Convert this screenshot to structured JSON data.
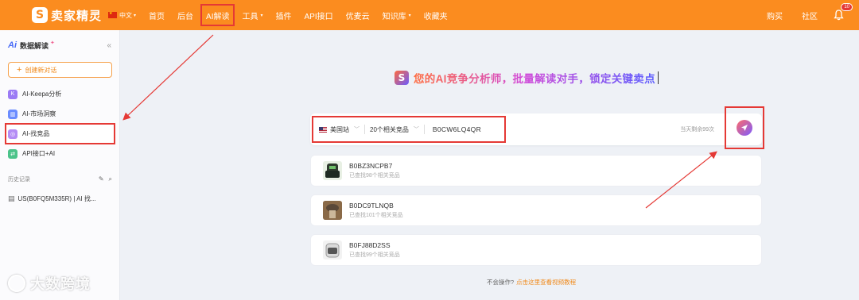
{
  "nav": {
    "logo_mark": "S",
    "brand": "卖家精灵",
    "lang": "中文",
    "items": [
      {
        "label": "首页",
        "caret": false
      },
      {
        "label": "后台",
        "caret": false
      },
      {
        "label": "AI解读",
        "caret": false
      },
      {
        "label": "工具",
        "caret": true
      },
      {
        "label": "插件",
        "caret": false
      },
      {
        "label": "API接口",
        "caret": false
      },
      {
        "label": "优麦云",
        "caret": false
      },
      {
        "label": "知识库",
        "caret": true
      },
      {
        "label": "收藏夹",
        "caret": false
      }
    ],
    "right": {
      "buy": "购买",
      "community": "社区",
      "notifications": "10"
    }
  },
  "sidebar": {
    "ai_mark": "Ai",
    "title": "数据解读",
    "new_chat": "创建新对话",
    "menu": [
      {
        "label": "AI-Keepa分析",
        "color": "#9b7bf5",
        "glyph": "K"
      },
      {
        "label": "AI-市场洞察",
        "color": "#6b8cff",
        "glyph": "▥"
      },
      {
        "label": "AI-找竞品",
        "color": "#b48cf5",
        "glyph": "◎"
      },
      {
        "label": "API接口+AI",
        "color": "#4cc38a",
        "glyph": "⇄"
      }
    ],
    "history_title": "历史记录",
    "history_items": [
      "US(B0FQ5M335R) | AI 找..."
    ]
  },
  "main": {
    "headline_logo": "S",
    "headline": "您的AI竞争分析师，批量解读对手，锁定关键卖点",
    "search": {
      "marketplace": "美国站",
      "competitor_count": "20个相关竞品",
      "asin": "B0CW6LQ4QR",
      "quota": "当天剩余99次"
    },
    "results": [
      {
        "asin": "B0BZ3NCPB7",
        "count": "已查找98个相关竞品"
      },
      {
        "asin": "B0DC9TLNQB",
        "count": "已查找101个相关竞品"
      },
      {
        "asin": "B0FJ88D2SS",
        "count": "已查找99个相关竞品"
      }
    ],
    "help_prefix": "不会操作?",
    "help_link": "点击这里查看视频教程"
  },
  "watermark": "大数跨境",
  "colors": {
    "brand_orange": "#fb8c1f",
    "annotation_red": "#e53935"
  }
}
